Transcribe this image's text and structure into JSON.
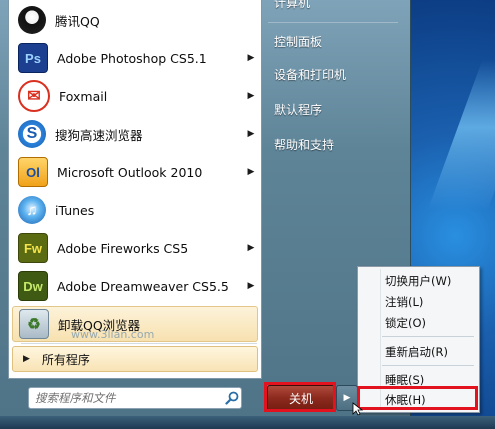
{
  "programs": [
    {
      "label": "腾讯QQ",
      "icon": "qq-penguin-icon",
      "arrow": false
    },
    {
      "label": "Adobe Photoshop CS5.1",
      "icon": "photoshop-icon",
      "icon_text": "Ps",
      "arrow": true
    },
    {
      "label": "Foxmail",
      "icon": "foxmail-icon",
      "arrow": true
    },
    {
      "label": "搜狗高速浏览器",
      "icon": "sogou-browser-icon",
      "arrow": true
    },
    {
      "label": "Microsoft Outlook 2010",
      "icon": "outlook-icon",
      "icon_text": "Ol",
      "arrow": true
    },
    {
      "label": "iTunes",
      "icon": "itunes-icon",
      "arrow": false
    },
    {
      "label": "Adobe Fireworks CS5",
      "icon": "fireworks-icon",
      "icon_text": "Fw",
      "arrow": true
    },
    {
      "label": "Adobe Dreamweaver CS5.5",
      "icon": "dreamweaver-icon",
      "icon_text": "Dw",
      "arrow": true
    },
    {
      "label": "卸载QQ浏览器",
      "icon": "recycle-bin-icon",
      "arrow": false
    }
  ],
  "all_programs": "所有程序",
  "search": {
    "placeholder": "搜索程序和文件"
  },
  "right_links": [
    "计算机",
    "控制面板",
    "设备和打印机",
    "默认程序",
    "帮助和支持"
  ],
  "shutdown": {
    "label": "关机"
  },
  "context_menu": {
    "items": [
      "切换用户(W)",
      "注销(L)",
      "锁定(O)",
      "重新启动(R)",
      "睡眠(S)",
      "休眠(H)"
    ]
  },
  "watermark": "www.3lian.com",
  "colors": {
    "highlight_red": "#e2131e",
    "menu_bg": "#ffffff",
    "accent_blue": "#1a5fae"
  }
}
